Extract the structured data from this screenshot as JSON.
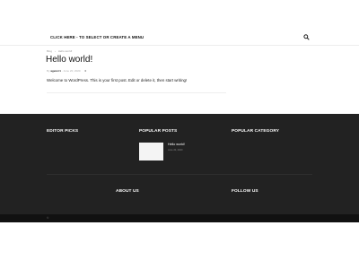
{
  "header": {
    "menu_link": "CLICK HERE - TO SELECT OR CREATE A MENU",
    "search_icon": "search-icon"
  },
  "post": {
    "breadcrumb": [
      "Blog",
      "›",
      "Hello world!"
    ],
    "title": "Hello world!",
    "meta": {
      "by": "By",
      "author": "agencr1",
      "date": "June 20, 2020",
      "comments": "0"
    },
    "content": "Welcome to WordPress. This is your first post. Edit or delete it, then start writing!"
  },
  "footer": {
    "editor_picks": "EDITOR PICKS",
    "popular_posts": "POPULAR POSTS",
    "popular_category": "POPULAR CATEGORY",
    "popular_post_item": {
      "title": "Hello world!",
      "date": "June 20, 2020"
    },
    "about_us": "ABOUT US",
    "follow_us": "FOLLOW US",
    "copyright": "©"
  }
}
